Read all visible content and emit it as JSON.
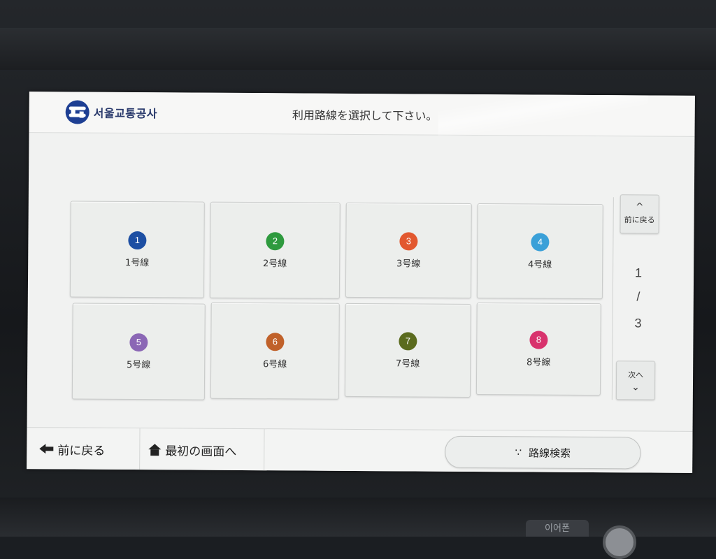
{
  "header": {
    "logo_text": "서울교통공사",
    "title": "利用路線を選択して下さい。"
  },
  "lines": [
    {
      "num": "1",
      "label": "1号線",
      "color": "#1d4fa3"
    },
    {
      "num": "2",
      "label": "2号線",
      "color": "#2e9a3e"
    },
    {
      "num": "3",
      "label": "3号線",
      "color": "#e2582f"
    },
    {
      "num": "4",
      "label": "4号線",
      "color": "#3aa0d8"
    },
    {
      "num": "5",
      "label": "5号線",
      "color": "#8b67b5"
    },
    {
      "num": "6",
      "label": "6号線",
      "color": "#c0612a"
    },
    {
      "num": "7",
      "label": "7号線",
      "color": "#5b6b1e"
    },
    {
      "num": "8",
      "label": "8号線",
      "color": "#d8336d"
    }
  ],
  "pager": {
    "prev_label": "前に戻る",
    "next_label": "次へ",
    "current": "1",
    "separator": "/",
    "total": "3"
  },
  "footer": {
    "back_label": "前に戻る",
    "home_label": "最初の画面へ",
    "search_label": "路線検索"
  },
  "device": {
    "earphone_label": "이어폰"
  }
}
